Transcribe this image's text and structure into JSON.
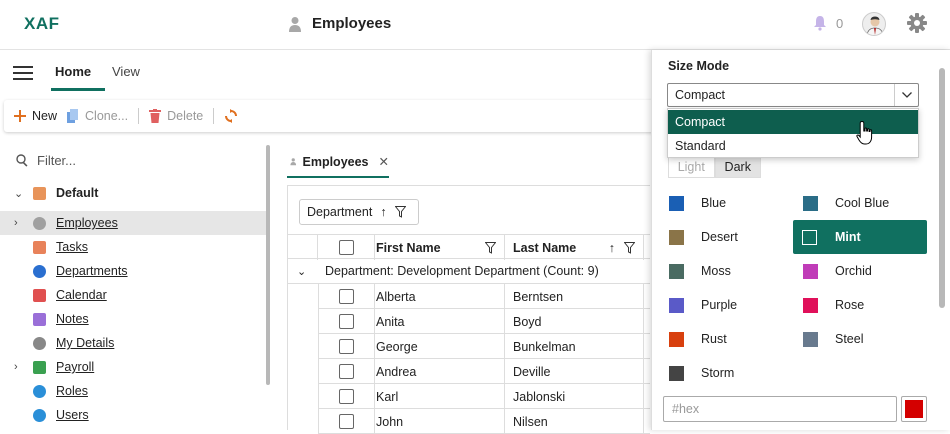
{
  "app": {
    "logo": "XAF",
    "page_title": "Employees",
    "notification_count": "0"
  },
  "ribbon": {
    "tabs": [
      "Home",
      "View"
    ]
  },
  "toolbar": {
    "new": "New",
    "clone": "Clone...",
    "delete": "Delete"
  },
  "nav": {
    "filter_placeholder": "Filter...",
    "group": "Default",
    "items": [
      {
        "label": "Employees",
        "color": "#a0a0a0"
      },
      {
        "label": "Tasks",
        "color": "#e8825a"
      },
      {
        "label": "Departments",
        "color": "#2a6fd0"
      },
      {
        "label": "Calendar",
        "color": "#e05050"
      },
      {
        "label": "Notes",
        "color": "#9a6fd8"
      },
      {
        "label": "My Details",
        "color": "#888888"
      },
      {
        "label": "Payroll",
        "color": "#3aa050"
      },
      {
        "label": "Roles",
        "color": "#2a8fd8"
      },
      {
        "label": "Users",
        "color": "#2a8fd8"
      }
    ]
  },
  "document_tab": "Employees",
  "grid": {
    "group_button": "Department",
    "columns": [
      "First Name",
      "Last Name"
    ],
    "group_row": "Department: Development Department (Count: 9)",
    "rows": [
      [
        "Alberta",
        "Berntsen"
      ],
      [
        "Anita",
        "Boyd"
      ],
      [
        "George",
        "Bunkelman"
      ],
      [
        "Andrea",
        "Deville"
      ],
      [
        "Karl",
        "Jablonski"
      ],
      [
        "John",
        "Nilsen"
      ]
    ]
  },
  "settings": {
    "size_mode_label": "Size Mode",
    "size_mode_value": "Compact",
    "size_options": [
      "Compact",
      "Standard"
    ],
    "theme_modes": [
      "Light",
      "Dark"
    ],
    "colors": [
      {
        "name": "Blue",
        "hex": "#1a5fb4"
      },
      {
        "name": "Cool Blue",
        "hex": "#2a6d87"
      },
      {
        "name": "Desert",
        "hex": "#8a7448"
      },
      {
        "name": "Mint",
        "hex": "#107060"
      },
      {
        "name": "Moss",
        "hex": "#4a6b62"
      },
      {
        "name": "Orchid",
        "hex": "#c03cb8"
      },
      {
        "name": "Purple",
        "hex": "#5a5ac8"
      },
      {
        "name": "Rose",
        "hex": "#e0105a"
      },
      {
        "name": "Rust",
        "hex": "#d8400e"
      },
      {
        "name": "Steel",
        "hex": "#687a8e"
      },
      {
        "name": "Storm",
        "hex": "#444444"
      }
    ],
    "active_color": "Mint",
    "hex_placeholder": "#hex",
    "hex_swatch": "#d40000"
  }
}
